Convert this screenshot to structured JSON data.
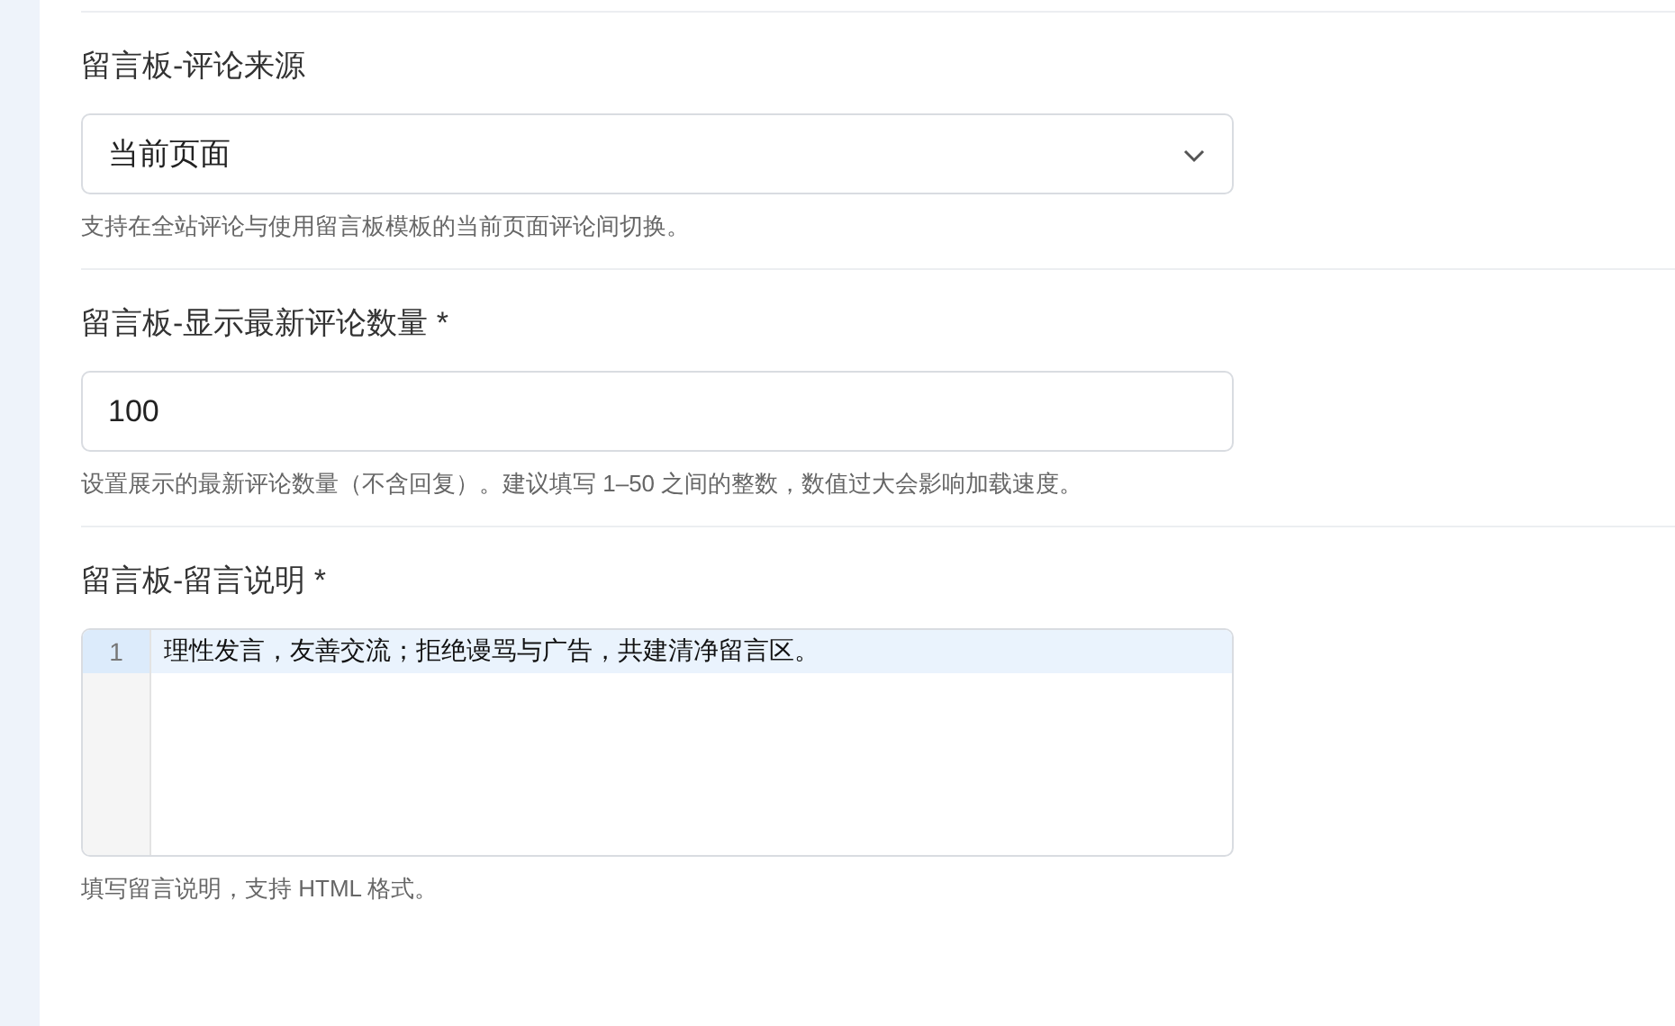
{
  "fields": [
    {
      "kind": "select",
      "label": "留言板-评论来源",
      "value": "当前页面",
      "hint": "支持在全站评论与使用留言板模板的当前页面评论间切换。"
    },
    {
      "kind": "input",
      "label": "留言板-显示最新评论数量 *",
      "value": "100",
      "hint": "设置展示的最新评论数量（不含回复）。建议填写 1–50 之间的整数，数值过大会影响加载速度。"
    },
    {
      "kind": "code",
      "label": "留言板-留言说明 *",
      "lines": [
        {
          "number": "1",
          "text": "理性发言，友善交流；拒绝谩骂与广告，共建清净留言区。",
          "selected": true
        }
      ],
      "hint": "填写留言说明，支持 HTML 格式。"
    }
  ]
}
